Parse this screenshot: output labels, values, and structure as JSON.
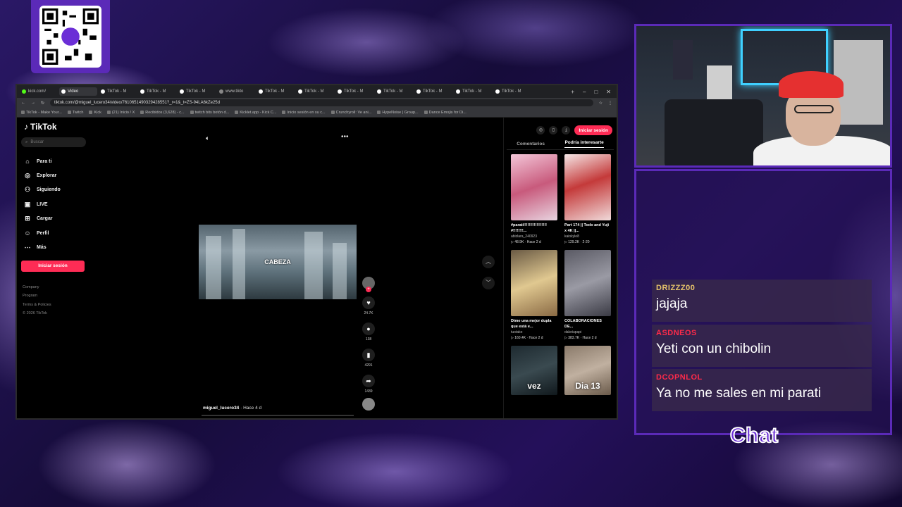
{
  "browser": {
    "tabs": [
      {
        "label": "kick.com/",
        "color": "#53fc18"
      },
      {
        "label": "Video",
        "color": "#ffffff"
      },
      {
        "label": "TikTok - M",
        "color": "#ffffff"
      },
      {
        "label": "TikTok - M",
        "color": "#ffffff"
      },
      {
        "label": "TikTok - M",
        "color": "#ffffff"
      },
      {
        "label": "www.tikto",
        "color": "#888888"
      },
      {
        "label": "TikTok - M",
        "color": "#ffffff"
      },
      {
        "label": "TikTok - M",
        "color": "#ffffff"
      },
      {
        "label": "TikTok - M",
        "color": "#ffffff"
      },
      {
        "label": "TikTok - M",
        "color": "#ffffff"
      },
      {
        "label": "TikTok - M",
        "color": "#ffffff"
      },
      {
        "label": "TikTok - M",
        "color": "#ffffff"
      },
      {
        "label": "TikTok - M",
        "color": "#ffffff"
      }
    ],
    "url": "tiktok.com/@miguel_lucero34/video/7610651490329428551?_r=1&_t=ZS-94LA6kZe25d",
    "bookmarks": [
      "TikTok - Make Your...",
      "Twitch",
      "Kick",
      "(21) Inicio / X",
      "Recibidos (3,628) - c...",
      "twitch bits botón d...",
      "Kicklet.app - Kick C...",
      "Inicio sesión en su c...",
      "Crunchyroll: Ve ani...",
      "HypeNoise | Group...",
      "Dance Emojis for Di..."
    ]
  },
  "tiktok": {
    "logo": "TikTok",
    "search_placeholder": "Buscar",
    "nav": [
      {
        "label": "Para ti",
        "icon": "home-icon",
        "glyph": "⌂"
      },
      {
        "label": "Explorar",
        "icon": "compass-icon",
        "glyph": "◎"
      },
      {
        "label": "Siguiendo",
        "icon": "user-follow-icon",
        "glyph": "⚇"
      },
      {
        "label": "LIVE",
        "icon": "live-icon",
        "glyph": "▣"
      },
      {
        "label": "Cargar",
        "icon": "upload-icon",
        "glyph": "⊞"
      },
      {
        "label": "Perfil",
        "icon": "profile-icon",
        "glyph": "☺"
      },
      {
        "label": "Más",
        "icon": "more-icon",
        "glyph": "⋯"
      }
    ],
    "login_button": "Iniciar sesión",
    "footer": [
      "Company",
      "Program",
      "Terms & Policies",
      "© 2026 TikTok"
    ],
    "video": {
      "caption": "CABEZA",
      "author": "miguel_lucero34",
      "time": "· Hace 4 d"
    },
    "actions": {
      "likes": "24.7K",
      "comments": "138",
      "saves": "4291",
      "shares": "1439"
    },
    "right": {
      "login_button": "Iniciar sesión",
      "tabs": [
        "Comentarios",
        "Podría interesarte"
      ],
      "cards": [
        {
          "title": "#parati!!!!!!!!!!!!!!!!!! #!!!!!!!!...",
          "user": "abizlara_240923",
          "views": "48.9K",
          "time": "Hace 2 d",
          "thumb_label": ""
        },
        {
          "title": "Part 174 || Todo and Yuji x 4K ||...",
          "user": "kaiokyle8",
          "views": "129.2K",
          "time": "2-20",
          "thumb_label": ""
        },
        {
          "title": "Dime una mejor dupla que está e...",
          "user": "tuotako",
          "views": "160.4K",
          "time": "Hace 2 d",
          "thumb_label": ""
        },
        {
          "title": "COLABORACIONES DE...",
          "user": "dakxtupapi",
          "views": "383.7K",
          "time": "Hace 2 d",
          "thumb_label": ""
        },
        {
          "title": "",
          "user": "",
          "views": "",
          "time": "",
          "thumb_label": "vez"
        },
        {
          "title": "",
          "user": "",
          "views": "",
          "time": "",
          "thumb_label": "Dia 13"
        }
      ]
    }
  },
  "chat": {
    "title": "Chat",
    "messages": [
      {
        "user": "DRIZZZ00",
        "text": "jajaja",
        "color": "#e8c56a"
      },
      {
        "user": "ASDNEOS",
        "text": "Yeti con un chibolin",
        "color": "#ff2a4a"
      },
      {
        "user": "DCOPNLOL",
        "text": "Ya no me sales en mi parati",
        "color": "#ff2a4a"
      }
    ]
  },
  "colors": {
    "tiktok_accent": "#fe2c55",
    "overlay_purple": "#5b2ab8",
    "neon_blue": "#3fd0ff"
  }
}
